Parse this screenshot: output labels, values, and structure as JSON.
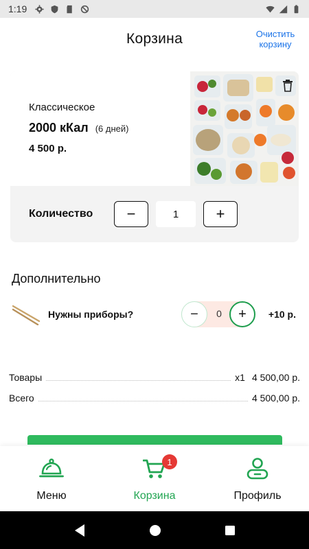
{
  "status_bar": {
    "time": "1:19"
  },
  "header": {
    "title": "Корзина",
    "clear_label": "Очистить корзину"
  },
  "product": {
    "name": "Классическое",
    "kcal": "2000 кКал",
    "days": "(6 дней)",
    "price": "4 500 р.",
    "quantity_label": "Количество",
    "quantity": "1",
    "minus": "−",
    "plus": "+"
  },
  "extras": {
    "title": "Дополнительно",
    "items": [
      {
        "label": "Нужны приборы?",
        "count": "0",
        "price": "+10 р.",
        "icon": "chopsticks-icon"
      }
    ]
  },
  "summary": {
    "goods_label": "Товары",
    "goods_qty": "x1",
    "goods_amount": "4 500,00 р.",
    "total_label": "Всего",
    "total_amount": "4 500,00 р."
  },
  "bottom_nav": {
    "items": [
      {
        "label": "Меню",
        "icon": "cloche-icon"
      },
      {
        "label": "Корзина",
        "icon": "cart-icon",
        "badge": "1",
        "active": true
      },
      {
        "label": "Профиль",
        "icon": "profile-icon"
      }
    ]
  },
  "colors": {
    "accent": "#22a552",
    "link": "#1a73e8",
    "badge": "#e53935"
  }
}
